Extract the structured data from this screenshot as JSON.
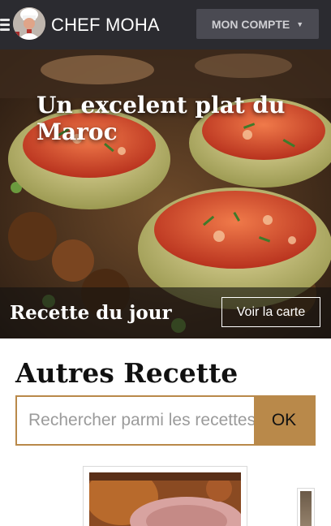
{
  "header": {
    "brand": "CHEF MOHA",
    "account_label": "MON COMPTE",
    "account_caret": "▼"
  },
  "hero": {
    "title": "Un excelent plat du Maroc",
    "caption": "Recette du jour",
    "map_button": "Voir la carte"
  },
  "other": {
    "title": "Autres Recette"
  },
  "search": {
    "placeholder": "Rechercher parmi les recettes",
    "button": "OK"
  },
  "colors": {
    "topbar": "#2b2b30",
    "accent": "#b9894a",
    "account_button": "#4a4a52"
  }
}
